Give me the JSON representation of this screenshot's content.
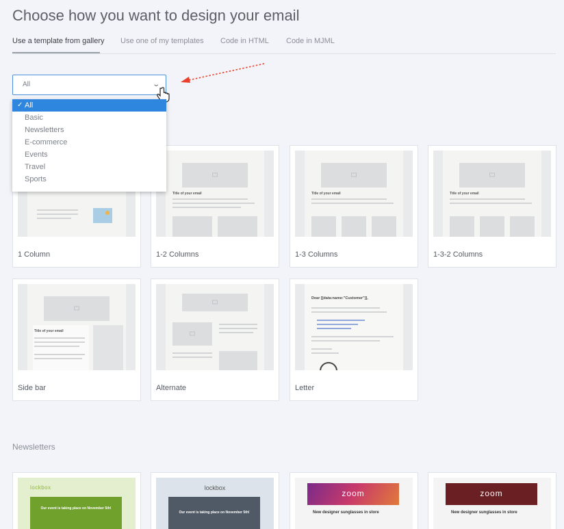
{
  "page": {
    "title": "Choose how you want to design your email"
  },
  "tabs": [
    {
      "label": "Use a template from gallery"
    },
    {
      "label": "Use one of my templates"
    },
    {
      "label": "Code in HTML"
    },
    {
      "label": "Code in MJML"
    }
  ],
  "filter": {
    "value": "All",
    "options": [
      "All",
      "Basic",
      "Newsletters",
      "E-commerce",
      "Events",
      "Travel",
      "Sports"
    ]
  },
  "templates": [
    {
      "label": "1 Column",
      "icon": "one-column-layout-icon"
    },
    {
      "label": "1-2 Columns",
      "heading": "Title of your email"
    },
    {
      "label": "1-3 Columns",
      "heading": "Title of your email"
    },
    {
      "label": "1-3-2 Columns",
      "heading": "Title of your email"
    },
    {
      "label": "Side bar",
      "heading": "Title of your email"
    },
    {
      "label": "Alternate"
    },
    {
      "label": "Letter",
      "heading": "Dear [[data:name:\"Customer\"]],"
    }
  ],
  "newsletters": {
    "title": "Newsletters",
    "cards": [
      {
        "brand": "lockbox",
        "text": "Our event is taking place on November 5th!"
      },
      {
        "brand": "lockbox",
        "text": "Our event is taking place on November 5th!"
      },
      {
        "brand": "zoom",
        "text": "New designer sunglasses in store"
      },
      {
        "brand": "zoom",
        "text": "New designer sunglasses in store"
      }
    ]
  },
  "colors": {
    "accent": "#2f86de",
    "selectBorder": "#4a90d9",
    "arrow": "#e8402a"
  }
}
